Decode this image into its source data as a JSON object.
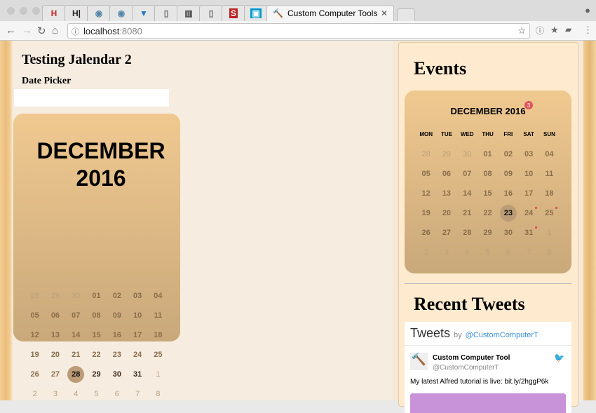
{
  "browser": {
    "tabs": [
      {
        "icon": "hacker-news-icon",
        "glyph": "H"
      },
      {
        "icon": "h-icon",
        "glyph": "H|"
      },
      {
        "icon": "reddit-icon",
        "glyph": "◉"
      },
      {
        "icon": "reddit-icon",
        "glyph": "◉"
      },
      {
        "icon": "download-icon",
        "glyph": "▼"
      },
      {
        "icon": "page-icon",
        "glyph": "▯"
      },
      {
        "icon": "book-icon",
        "glyph": "▥"
      },
      {
        "icon": "page-icon",
        "glyph": "▯"
      },
      {
        "icon": "s-icon",
        "glyph": "S"
      },
      {
        "icon": "trello-icon",
        "glyph": "▣"
      }
    ],
    "active_tab": "Custom Computer Tools",
    "url_host": "localhost",
    "url_port": ":8080"
  },
  "main": {
    "title": "Testing Jalendar 2",
    "date_picker_label": "Date Picker",
    "date_picker_value": "",
    "calendar": {
      "month": "DECEMBER",
      "year": "2016",
      "weeks": [
        [
          [
            "28",
            "muted"
          ],
          [
            "29",
            "muted"
          ],
          [
            "30",
            "muted"
          ],
          [
            "01",
            ""
          ],
          [
            "02",
            ""
          ],
          [
            "03",
            ""
          ],
          [
            "04",
            ""
          ]
        ],
        [
          [
            "05",
            ""
          ],
          [
            "06",
            ""
          ],
          [
            "07",
            ""
          ],
          [
            "08",
            ""
          ],
          [
            "09",
            ""
          ],
          [
            "10",
            ""
          ],
          [
            "11",
            ""
          ]
        ],
        [
          [
            "12",
            ""
          ],
          [
            "13",
            ""
          ],
          [
            "14",
            ""
          ],
          [
            "15",
            ""
          ],
          [
            "16",
            ""
          ],
          [
            "17",
            ""
          ],
          [
            "18",
            ""
          ]
        ],
        [
          [
            "19",
            ""
          ],
          [
            "20",
            ""
          ],
          [
            "21",
            ""
          ],
          [
            "22",
            ""
          ],
          [
            "23",
            ""
          ],
          [
            "24",
            ""
          ],
          [
            "25",
            ""
          ]
        ],
        [
          [
            "26",
            ""
          ],
          [
            "27",
            ""
          ],
          [
            "28",
            "sel"
          ],
          [
            "29",
            "dark"
          ],
          [
            "30",
            "dark"
          ],
          [
            "31",
            "dark"
          ],
          [
            "1",
            "muted"
          ]
        ],
        [
          [
            "2",
            "muted"
          ],
          [
            "3",
            "muted"
          ],
          [
            "4",
            "muted"
          ],
          [
            "5",
            "muted"
          ],
          [
            "6",
            "muted"
          ],
          [
            "7",
            "muted"
          ],
          [
            "8",
            "muted"
          ]
        ]
      ]
    }
  },
  "sidebar": {
    "events_title": "Events",
    "calendar": {
      "title": "DECEMBER 2016",
      "event_count": "3",
      "days": [
        "MON",
        "TUE",
        "WED",
        "THU",
        "FRI",
        "SAT",
        "SUN"
      ],
      "weeks": [
        [
          [
            "28",
            "muted"
          ],
          [
            "29",
            "muted"
          ],
          [
            "30",
            "muted"
          ],
          [
            "01",
            ""
          ],
          [
            "02",
            ""
          ],
          [
            "03",
            ""
          ],
          [
            "04",
            ""
          ]
        ],
        [
          [
            "05",
            ""
          ],
          [
            "06",
            ""
          ],
          [
            "07",
            ""
          ],
          [
            "08",
            ""
          ],
          [
            "09",
            ""
          ],
          [
            "10",
            ""
          ],
          [
            "11",
            ""
          ]
        ],
        [
          [
            "12",
            ""
          ],
          [
            "13",
            ""
          ],
          [
            "14",
            ""
          ],
          [
            "15",
            ""
          ],
          [
            "16",
            ""
          ],
          [
            "17",
            ""
          ],
          [
            "18",
            ""
          ]
        ],
        [
          [
            "19",
            ""
          ],
          [
            "20",
            ""
          ],
          [
            "21",
            ""
          ],
          [
            "22",
            ""
          ],
          [
            "23",
            "sel"
          ],
          [
            "24",
            "event"
          ],
          [
            "25",
            "event"
          ]
        ],
        [
          [
            "26",
            ""
          ],
          [
            "27",
            ""
          ],
          [
            "28",
            ""
          ],
          [
            "29",
            ""
          ],
          [
            "30",
            ""
          ],
          [
            "31",
            "event"
          ],
          [
            "1",
            "muted"
          ]
        ],
        [
          [
            "2",
            "muted"
          ],
          [
            "3",
            "muted"
          ],
          [
            "4",
            "muted"
          ],
          [
            "5",
            "muted"
          ],
          [
            "6",
            "muted"
          ],
          [
            "7",
            "muted"
          ],
          [
            "8",
            "muted"
          ]
        ]
      ]
    },
    "tweets_title": "Recent Tweets",
    "timeline": {
      "heading": "Tweets",
      "by": "by",
      "handle_link": "@CustomComputerT",
      "tweet": {
        "name": "Custom Computer Tool",
        "handle": "@CustomComputerT",
        "text": "My latest Alfred tutorial is live:  bit.ly/2hggP6k"
      }
    }
  }
}
